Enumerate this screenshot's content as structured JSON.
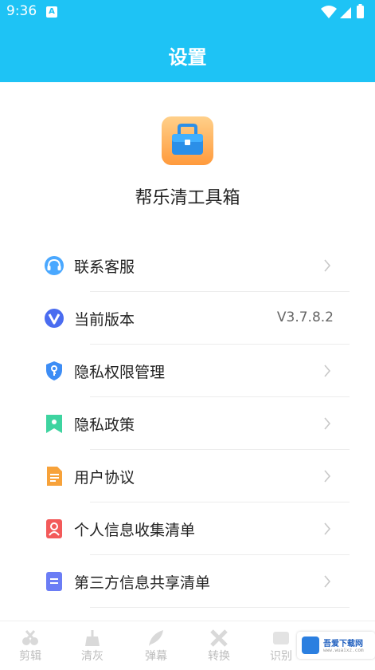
{
  "status_bar": {
    "time": "9:36",
    "notification_icon": "A"
  },
  "header": {
    "title": "设置"
  },
  "app": {
    "name": "帮乐清工具箱",
    "icon": "toolbox-icon"
  },
  "menu": {
    "items": [
      {
        "label": "联系客服",
        "icon": "headset-icon"
      },
      {
        "label": "当前版本",
        "icon": "version-icon",
        "value": "V3.7.8.2"
      },
      {
        "label": "隐私权限管理",
        "icon": "shield-key-icon"
      },
      {
        "label": "隐私政策",
        "icon": "bookmark-icon"
      },
      {
        "label": "用户协议",
        "icon": "document-icon"
      },
      {
        "label": "个人信息收集清单",
        "icon": "person-list-icon"
      },
      {
        "label": "第三方信息共享清单",
        "icon": "share-list-icon"
      }
    ]
  },
  "tabbar": {
    "tabs": [
      {
        "label": "剪辑"
      },
      {
        "label": "清灰"
      },
      {
        "label": "弹幕"
      },
      {
        "label": "转换"
      },
      {
        "label": "识别"
      }
    ]
  },
  "watermark": {
    "text": "吾爱下载网",
    "sub": "www.wuaixz.com"
  },
  "colors": {
    "header": "#1ec3f5",
    "text": "#222222",
    "muted": "#bdbdbd"
  }
}
